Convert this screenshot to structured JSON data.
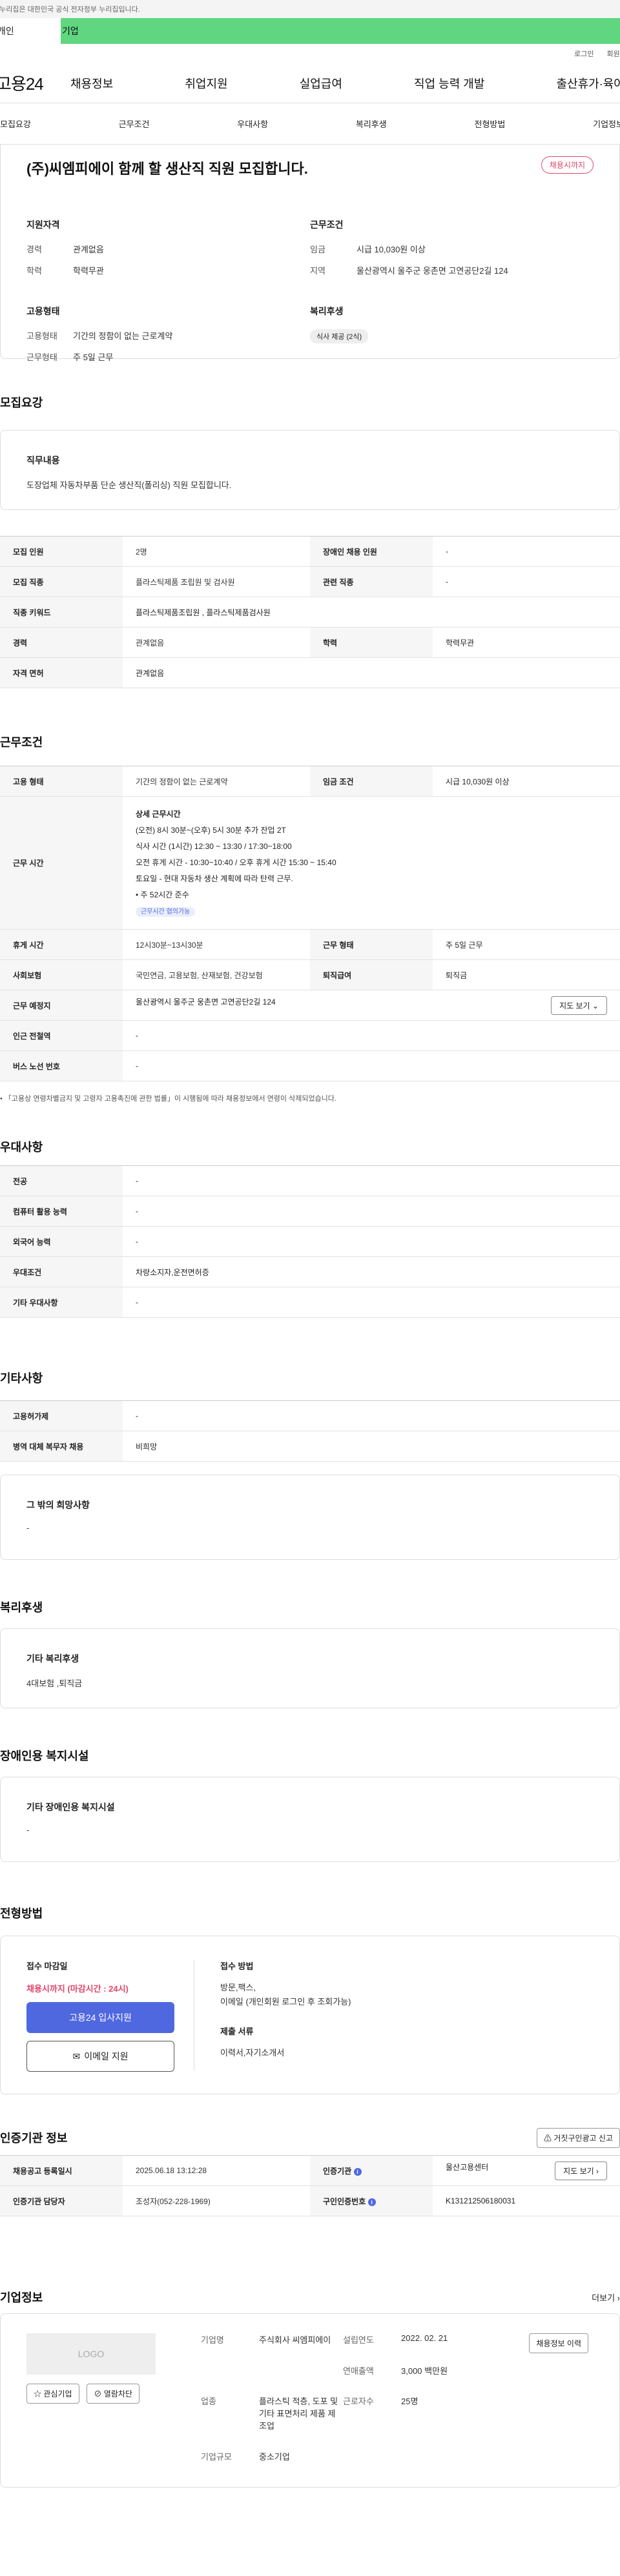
{
  "gov_bar": "이 누리집은 대한민국 공식 전자정부 누리집입니다.",
  "top_tabs": [
    "개인",
    "기업"
  ],
  "util": [
    "로그인",
    "회원가입"
  ],
  "logo": "고용24",
  "gnb": [
    "채용정보",
    "취업지원",
    "실업급여",
    "직업 능력 개발",
    "출산휴가·육아휴직"
  ],
  "subnav": [
    "모집요강",
    "근무조건",
    "우대사항",
    "복리후생",
    "전형방법",
    "기업정보"
  ],
  "title": "(주)씨엠피에이 함께 할 생산직 직원 모집합니다.",
  "status_badge": "채용시까지",
  "summary": {
    "qual_h": "지원자격",
    "qual": [
      [
        "경력",
        "관계없음"
      ],
      [
        "학력",
        "학력무관"
      ]
    ],
    "work_h": "근무조건",
    "work": [
      [
        "임금",
        "시급 10,030원 이상"
      ],
      [
        "지역",
        "울산광역시 울주군 웅촌면 고연공단2길 124"
      ]
    ],
    "emp_h": "고용형태",
    "emp": [
      [
        "고용형태",
        "기간의 정함이 없는 근로계약"
      ],
      [
        "근무형태",
        "주 5일 근무"
      ]
    ],
    "welfare_h": "복리후생",
    "welfare_pill": "식사 제공 (2식)"
  },
  "recruit": {
    "title": "모집요강",
    "job_h": "직무내용",
    "job_v": "도장업체 자동차부품 단순 생산직(폴리싱) 직원 모집합니다.",
    "rows": [
      [
        "모집 인원",
        "2명",
        "장애인 채용 인원",
        "-"
      ],
      [
        "모집 직종",
        "플라스틱제품 조립원 및 검사원",
        "관련 직종",
        "-"
      ],
      [
        "직종 키워드",
        "플라스틱제품조립원 , 플라스틱제품검사원",
        "",
        ""
      ],
      [
        "경력",
        "관계없음",
        "학력",
        "학력무관"
      ],
      [
        "자격 면허",
        "관계없음",
        "",
        ""
      ]
    ]
  },
  "work": {
    "title": "근무조건",
    "emp_type_k": "고용 형태",
    "emp_type_v": "기간의 정함이 없는 근로계약",
    "wage_k": "임금 조건",
    "wage_v": "시급 10,030원 이상",
    "hours_k": "근무 시간",
    "hours_h": "상세 근무시간",
    "hours_lines": [
      "(오전) 8시 30분~(오후) 5시 30분  추가 잔업 2T",
      "식사 시간 (1시간)  12:30 ~ 13:30  / 17:30~18:00",
      "오전 휴게 시간 - 10:30~10:40  /  오후 휴게 시간 15:30 ~ 15:40",
      "토요일 - 현대 자동차 생산 계획에 따라 탄력 근무.",
      "• 주 52시간 준수"
    ],
    "hours_tag": "근무시간 협의가능",
    "rows": [
      [
        "휴게 시간",
        "12시30분~13시30분",
        "근무 형태",
        "주 5일 근무"
      ],
      [
        "사회보험",
        "국민연금, 고용보험, 산재보험, 건강보험",
        "퇴직급여",
        "퇴직금"
      ]
    ],
    "place_k": "근무 예정지",
    "place_v": "울산광역시 울주군 웅촌면 고연공단2길 124",
    "map_btn": "지도 보기",
    "station_k": "인근 전철역",
    "station_v": "-",
    "bus_k": "버스 노선 번호",
    "bus_v": "-",
    "note": "• 「고용상 연령차별금지 및 고령자 고용촉진에 관한 법률」이 시행됨에 따라 채용정보에서 연령이 삭제되었습니다."
  },
  "pref": {
    "title": "우대사항",
    "rows": [
      [
        "전공",
        "-"
      ],
      [
        "컴퓨터 활용 능력",
        "-"
      ],
      [
        "외국어 능력",
        "-"
      ],
      [
        "우대조건",
        "차량소지자,운전면허증"
      ],
      [
        "기타 우대사항",
        "-"
      ]
    ]
  },
  "etc": {
    "title": "기타사항",
    "rows": [
      [
        "고용허가제",
        "-"
      ],
      [
        "병역 대체 복무자 채용",
        "비희망"
      ]
    ],
    "other_h": "그 밖의 희망사항",
    "other_v": "-"
  },
  "welfare": {
    "title": "복리후생",
    "h": "기타 복리후생",
    "v": "4대보험 ,퇴직금"
  },
  "disabled": {
    "title": "장애인용 복지시설",
    "h": "기타 장애인용 복지시설",
    "v": "-"
  },
  "apply": {
    "title": "전형방법",
    "deadline_h": "접수 마감일",
    "deadline_v": "채용시까지 (마감시간 : 24시)",
    "apply_btn": "고용24 입사지원",
    "email_btn": "이메일 지원",
    "method_h": "접수 방법",
    "method_v1": "방문,팩스,",
    "method_v2": "이메일 (개인회원 로그인 후 조회가능)",
    "docs_h": "제출 서류",
    "docs_v": "이력서,자기소개서"
  },
  "agency": {
    "title": "인증기관 정보",
    "report_btn": "거짓구인광고 신고",
    "rows": [
      [
        "채용공고 등록일시",
        "2025.06.18 13:12:28",
        "인증기관",
        "울산고용센터"
      ],
      [
        "인증기관 담당자",
        "조성자(052-228-1969)",
        "구인인증번호",
        "K131212506180031"
      ]
    ],
    "map_btn": "지도 보기"
  },
  "company": {
    "title": "기업정보",
    "more": "더보기",
    "logo": "LOGO",
    "fav_btn": "관심기업",
    "block_btn": "열람차단",
    "history_btn": "채용정보 이력",
    "name_k": "기업명",
    "name_v": "주식회사 씨엠피에이",
    "est_k": "설립연도",
    "est_v": "2022. 02. 21",
    "rev_k": "연매출액",
    "rev_v": "3,000 백만원",
    "ind_k": "업종",
    "ind_v": "플라스틱 적층, 도포 및 기타 표면처리 제품 제조업",
    "emp_k": "근로자수",
    "emp_v": "25명",
    "size_k": "기업규모",
    "size_v": "중소기업"
  }
}
